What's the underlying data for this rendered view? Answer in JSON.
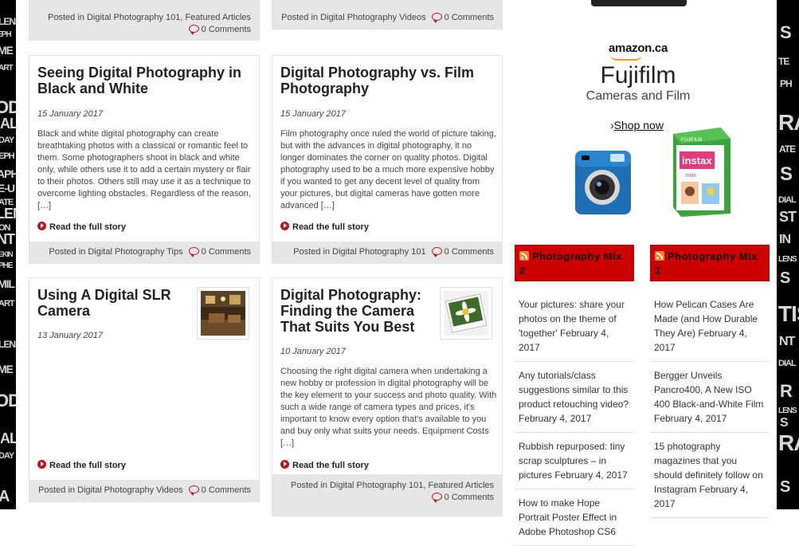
{
  "left_wall_words": [
    "LENS",
    "EPH",
    "ME",
    "ART",
    "OD",
    "IAL",
    "DAY",
    "EPH",
    "APH",
    "E-U",
    "ATE",
    "LEN",
    "ON",
    "NT",
    "EKIN",
    "PHE",
    "MIL",
    "ART",
    "LENS",
    "ME",
    "OD",
    "IAL",
    "DAY",
    "A"
  ],
  "right_wall_words": [
    "S",
    "TE",
    "PH",
    "RA",
    "ATE",
    "S",
    "DIAL",
    "ST",
    "IN",
    "LENS",
    "S",
    "TIS",
    "NT",
    "DIAL",
    "R",
    "LENS",
    "S",
    "RA",
    "S"
  ],
  "posts": [
    {
      "id": "post-top-left",
      "title": "",
      "footer_prefix": "Posted in ",
      "categories": "Digital Photography 101, Featured Articles",
      "comments": "0 Comments"
    },
    {
      "id": "post-top-right",
      "title": "",
      "footer_prefix": "Posted in ",
      "categories": "Digital Photography Videos",
      "comments": "0 Comments"
    },
    {
      "id": "post-bw",
      "title": "Seeing Digital Photography in Black and White",
      "date": "15 January 2017",
      "excerpt": "Black and white digital photography can create breathtaking photos with a classical or romantic feel to them. Some photographers shoot in black and white only, while others use it to add a certain mystery or flair to their photos. Others still may use it as a technique to overcome lighting obstacles. Regardless of the reason, […]",
      "read_more": "Read the full story",
      "footer_prefix": "Posted in ",
      "categories": "Digital Photography Tips",
      "comments": "0 Comments"
    },
    {
      "id": "post-vs-film",
      "title": "Digital Photography vs. Film Photography",
      "date": "15 January 2017",
      "excerpt": "Film photography once ruled the world of picture taking, but with the advances in digital photography, it no longer dominates the corner on quality photos. Digital photography used to be a much more expensive hobby if you wanted to get any decent level of quality from your pictures, but digital cameras have gotten more advanced […]",
      "read_more": "Read the full story",
      "footer_prefix": "Posted in ",
      "categories": "Digital Photography 101",
      "comments": "0 Comments"
    },
    {
      "id": "post-slr",
      "title": "Using A Digital SLR Camera",
      "date": "13 January 2017",
      "excerpt": "",
      "read_more": "Read the full story",
      "footer_prefix": "Posted in ",
      "categories": "Digital Photography Videos",
      "comments": "0 Comments"
    },
    {
      "id": "post-finding-camera",
      "title": "Digital Photography: Finding the Camera That Suits You Best",
      "date": "10 January 2017",
      "excerpt": "Choosing the right digital camera when undertaking a new hobby or profession in digital photography will be the key element to your success and photo quality. With such a wide range of camera types and prices, it's important to know every option that's available to you and buy only what suits your needs. Equipment Costs […]",
      "read_more": "Read the full story",
      "footer_prefix": "Posted in ",
      "categories": "Digital Photography 101, Featured Articles",
      "comments": "0 Comments"
    }
  ],
  "ad": {
    "store": "amazon.ca",
    "brand": "Fujifilm",
    "tagline": "Cameras and Film",
    "cta": "Shop now",
    "cta_glyph": "›",
    "film_box_brand": "FUJIFILM",
    "film_box_name": "instax",
    "film_box_sub": "mini",
    "colors": {
      "camera_blue": "#1f6fb5",
      "box_green": "#3aa53a",
      "amazon_orange": "#ff9900"
    }
  },
  "widgets": [
    {
      "title": "Photography Mix 2",
      "items": [
        "Your pictures: share your photos on the theme of 'together' February 4, 2017",
        "Any tutorials/class suggestions similar to this product retouching video? February 4, 2017",
        "Rubbish repurposed: tiny scrap sculptures – in pictures February 4, 2017",
        "How to make Hope Portrait Poster Effect in Adobe Photoshop CS6"
      ]
    },
    {
      "title": "Photography Mix 1",
      "items": [
        "How Pelican Cases Are Made (and How Durable They Are) February 4, 2017",
        "Bergger Unveils Pancro400, A New ISO 400 Black-and-White Film February 4, 2017",
        "15 photography magazines that you should definitely follow on Instagram February 4, 2017"
      ]
    }
  ],
  "colors": {
    "accent_red": "#cc0000",
    "footer_bg": "#e6e6e6",
    "rss_orange": "#f58220"
  }
}
